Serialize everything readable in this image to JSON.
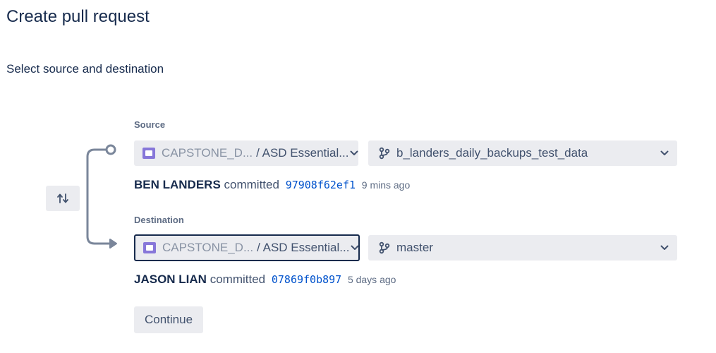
{
  "header": {
    "title": "Create pull request",
    "subtitle": "Select source and destination"
  },
  "source": {
    "label": "Source",
    "project": "CAPSTONE_D...",
    "repo": "/ ASD Essential...",
    "branch": "b_landers_daily_backups_test_data",
    "commit": {
      "author": "BEN LANDERS",
      "verb": "committed",
      "hash": "97908f62ef1",
      "time": "9 mins ago"
    }
  },
  "destination": {
    "label": "Destination",
    "project": "CAPSTONE_D...",
    "repo": "/ ASD Essential...",
    "branch": "master",
    "commit": {
      "author": "JASON LIAN",
      "verb": "committed",
      "hash": "07869f0b897",
      "time": "5 days ago"
    }
  },
  "actions": {
    "continue_label": "Continue",
    "swap_icon": "swap-vertical-icon"
  },
  "colors": {
    "text_primary": "#172b4d",
    "text_secondary": "#42526e",
    "muted": "#8993a4",
    "link": "#0052cc",
    "repo_icon": "#8777d9",
    "field_background": "#ebecf0",
    "connector": "#7a869a"
  }
}
